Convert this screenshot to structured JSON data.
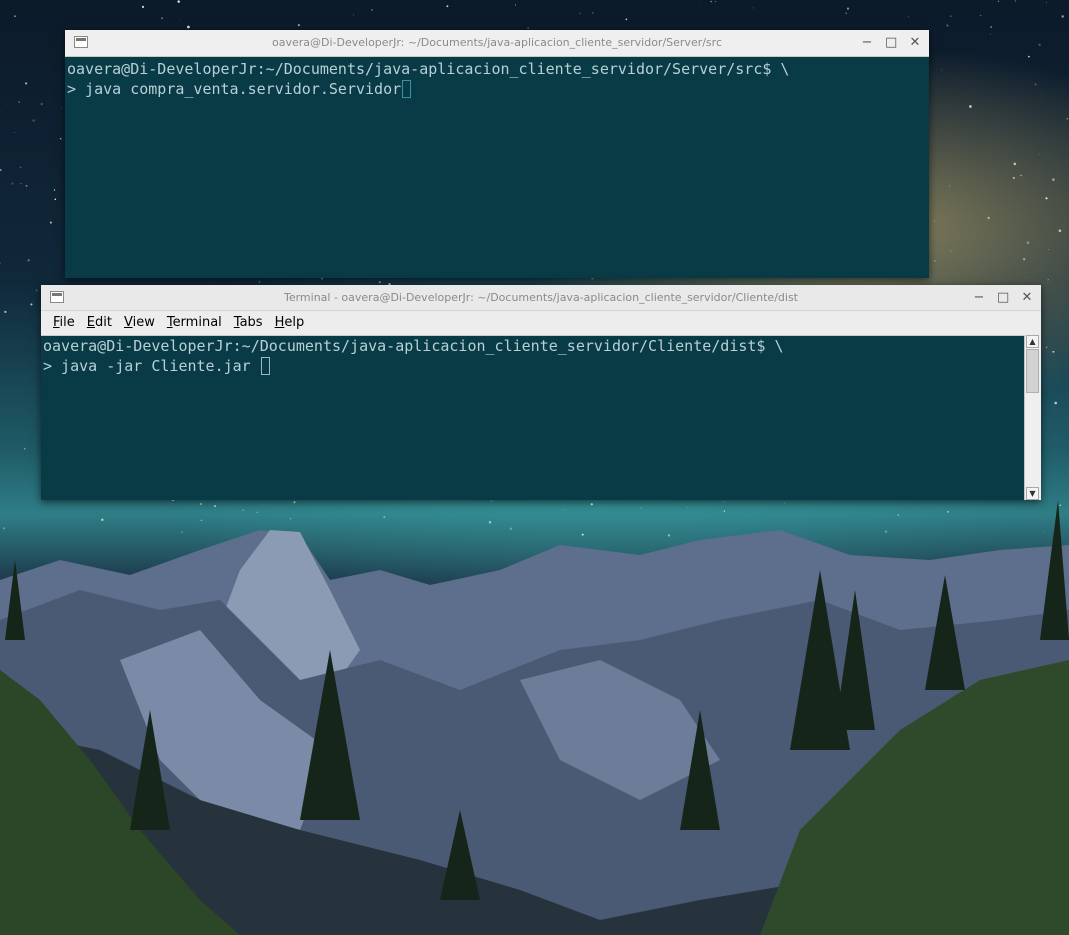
{
  "desktop": {
    "wallpaper": "night-sky-mountain-landscape"
  },
  "server_window": {
    "title": "oavera@Di-DeveloperJr: ~/Documents/java-aplicacion_cliente_servidor/Server/src",
    "lines": [
      "oavera@Di-DeveloperJr:~/Documents/java-aplicacion_cliente_servidor/Server/src$ \\",
      "> java compra_venta.servidor.Servidor"
    ],
    "controls": {
      "minimize": "−",
      "maximize": "□",
      "close": "✕"
    }
  },
  "client_window": {
    "title": "Terminal - oavera@Di-DeveloperJr: ~/Documents/java-aplicacion_cliente_servidor/Cliente/dist",
    "menu": {
      "file": {
        "u": "F",
        "rest": "ile"
      },
      "edit": {
        "u": "E",
        "rest": "dit"
      },
      "view": {
        "u": "V",
        "rest": "iew"
      },
      "terminal": {
        "u": "T",
        "rest": "erminal"
      },
      "tabs": {
        "u": "T",
        "rest": "abs"
      },
      "help": {
        "u": "H",
        "rest": "elp"
      }
    },
    "lines": [
      "oavera@Di-DeveloperJr:~/Documents/java-aplicacion_cliente_servidor/Cliente/dist$ \\",
      "> java -jar Cliente.jar "
    ],
    "controls": {
      "minimize": "−",
      "maximize": "□",
      "close": "✕"
    },
    "scroll": {
      "up": "▲",
      "down": "▼"
    }
  },
  "colors": {
    "terminal_bg": "#083b46",
    "terminal_fg": "#b8cfd6",
    "titlebar": "#efefef"
  }
}
